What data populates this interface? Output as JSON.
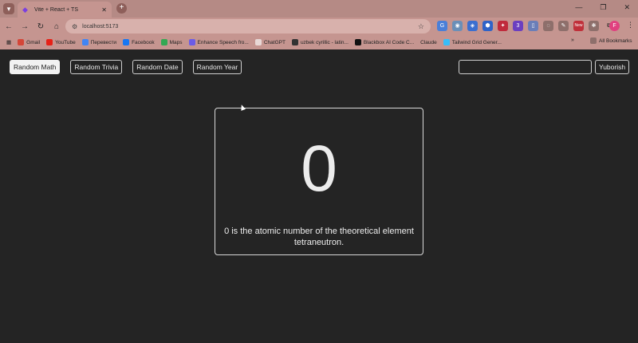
{
  "browser": {
    "tab_title": "Vite + React + TS",
    "url": "localhost:5173",
    "bookmarks": [
      "Gmail",
      "YouTube",
      "Перевести",
      "Facebook",
      "Maps",
      "Enhance Speech fro...",
      "ChatGPT",
      "uzbek cyrillic - latin...",
      "Blackbox AI Code C...",
      "Claude",
      "Tailwind Grid Gener..."
    ],
    "all_bookmarks": "All Bookmarks",
    "profile_initial": "F",
    "new_badge": "New",
    "ext_badge": "3"
  },
  "nav": {
    "random_math": "Random Math",
    "random_trivia": "Random Trivia",
    "random_date": "Random Date",
    "random_year": "Random Year"
  },
  "search": {
    "value": "",
    "button": "Yuborish"
  },
  "result": {
    "number": "0",
    "fact": "0 is the atomic number of the theoretical element tetraneutron."
  },
  "colors": {
    "chrome": "#c59590",
    "page_bg": "#242424"
  }
}
